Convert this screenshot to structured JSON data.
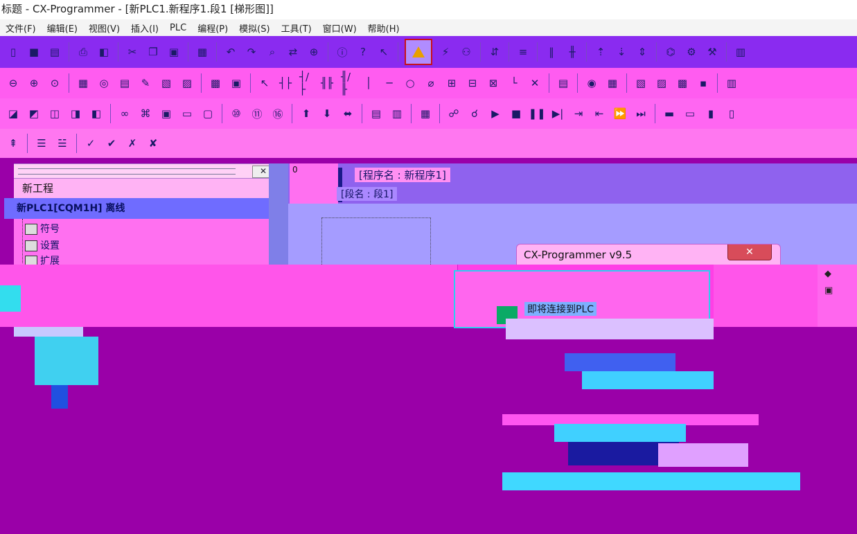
{
  "window": {
    "title": "标题 - CX-Programmer - [新PLC1.新程序1.段1 [梯形图]]"
  },
  "menu": {
    "items": [
      {
        "label": "文件(F)"
      },
      {
        "label": "编辑(E)"
      },
      {
        "label": "视图(V)"
      },
      {
        "label": "插入(I)"
      },
      {
        "label": "PLC"
      },
      {
        "label": "编程(P)"
      },
      {
        "label": "模拟(S)"
      },
      {
        "label": "工具(T)"
      },
      {
        "label": "窗口(W)"
      },
      {
        "label": "帮助(H)"
      }
    ]
  },
  "workspace": {
    "close_label": "✕",
    "project_label": "新工程",
    "plc_label": "新PLC1[CQM1H] 离线",
    "nodes": [
      {
        "label": "符号"
      },
      {
        "label": "设置"
      },
      {
        "label": "扩展"
      }
    ]
  },
  "ladder": {
    "rung_number": "0",
    "program_name": "[程序名 : 新程序1]",
    "section_name": "[段名 : 段1]"
  },
  "dialog": {
    "title": "CX-Programmer v9.5",
    "close_label": "✕",
    "message": "即将连接到PLC"
  },
  "colors": {
    "warning_highlight": "#c8101a"
  }
}
